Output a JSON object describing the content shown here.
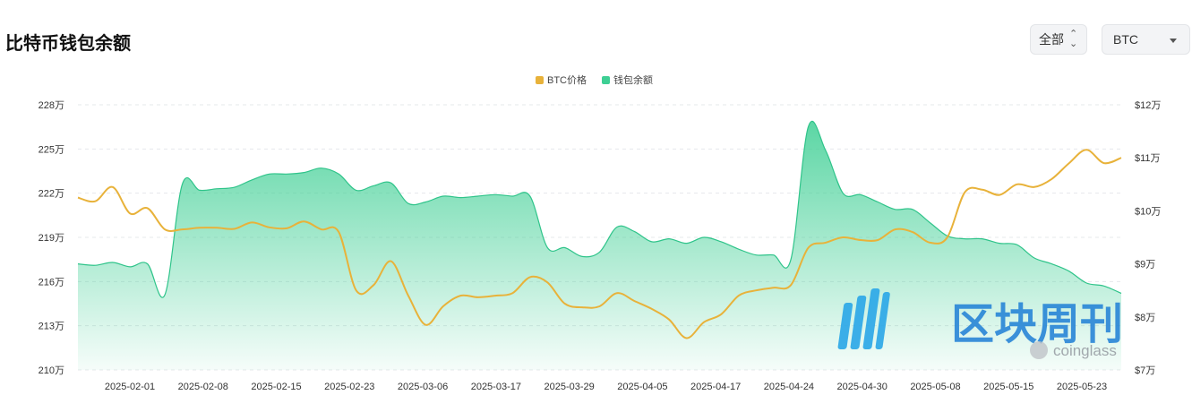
{
  "header": {
    "title": "比特币钱包余额",
    "range_select": {
      "value": "全部"
    },
    "coin_select": {
      "value": "BTC"
    }
  },
  "colors": {
    "price_line": "#e8b23a",
    "balance_fill_top": "#3ecf94",
    "balance_line": "#2fc48a",
    "grid": "#e6e8eb"
  },
  "watermark": {
    "brand_cn": "区块周刊",
    "brand_en": "coinglass"
  },
  "chart_data": {
    "type": "area",
    "legend": [
      {
        "name": "BTC价格",
        "color": "#e8b23a"
      },
      {
        "name": "钱包余额",
        "color": "#3ecf94"
      }
    ],
    "legend_position": "top-center",
    "grid": true,
    "x_tick_labels": [
      "2025-02-01",
      "2025-02-08",
      "2025-02-15",
      "2025-02-23",
      "2025-03-06",
      "2025-03-17",
      "2025-03-29",
      "2025-04-05",
      "2025-04-17",
      "2025-04-24",
      "2025-04-30",
      "2025-05-08",
      "2025-05-15",
      "2025-05-23"
    ],
    "y_left": {
      "min": 2100000,
      "max": 2280000,
      "ticks": [
        2100000,
        2130000,
        2160000,
        2190000,
        2220000,
        2250000,
        2280000
      ],
      "tick_labels": [
        "210万",
        "213万",
        "216万",
        "219万",
        "222万",
        "225万",
        "228万"
      ]
    },
    "y_right": {
      "min": 70000,
      "max": 120000,
      "ticks": [
        70000,
        80000,
        90000,
        100000,
        110000,
        120000
      ],
      "tick_labels": [
        "$7万",
        "$8万",
        "$9万",
        "$10万",
        "$11万",
        "$12万"
      ]
    },
    "x": [
      "01-27",
      "01-29",
      "01-31",
      "02-02",
      "02-04",
      "02-06",
      "02-08",
      "02-10",
      "02-12",
      "02-14",
      "02-16",
      "02-18",
      "02-20",
      "02-22",
      "02-24",
      "02-26",
      "02-28",
      "03-02",
      "03-04",
      "03-06",
      "03-08",
      "03-10",
      "03-12",
      "03-14",
      "03-16",
      "03-18",
      "03-20",
      "03-22",
      "03-24",
      "03-26",
      "03-28",
      "03-30",
      "04-01",
      "04-03",
      "04-05",
      "04-07",
      "04-09",
      "04-11",
      "04-13",
      "04-15",
      "04-17",
      "04-19",
      "04-21",
      "04-23",
      "04-25",
      "04-27",
      "04-29",
      "05-01",
      "05-03",
      "05-05",
      "05-07",
      "05-09",
      "05-11",
      "05-13",
      "05-15",
      "05-17",
      "05-19",
      "05-21",
      "05-23",
      "05-25",
      "05-27"
    ],
    "series": [
      {
        "name": "钱包余额",
        "axis": "left",
        "values": [
          2172000,
          2171000,
          2173000,
          2170000,
          2172000,
          2151000,
          2226000,
          2222000,
          2223000,
          2224000,
          2229000,
          2233000,
          2233000,
          2234000,
          2237000,
          2233000,
          2222000,
          2225000,
          2227000,
          2213000,
          2214000,
          2218000,
          2217000,
          2218000,
          2219000,
          2218000,
          2218000,
          2183000,
          2183000,
          2177000,
          2180000,
          2197000,
          2194000,
          2187000,
          2189000,
          2186000,
          2190000,
          2187000,
          2182000,
          2178000,
          2178000,
          2175000,
          2265000,
          2249000,
          2220000,
          2219000,
          2214000,
          2209000,
          2209000,
          2200000,
          2191000,
          2189000,
          2189000,
          2186000,
          2185000,
          2176000,
          2172000,
          2167000,
          2159000,
          2157000,
          2152000
        ]
      },
      {
        "name": "BTC价格",
        "axis": "right",
        "values": [
          102500,
          101800,
          104500,
          99500,
          100500,
          96500,
          96500,
          96800,
          96800,
          96600,
          97800,
          96900,
          96700,
          98000,
          96500,
          96000,
          85000,
          86000,
          90500,
          84000,
          78500,
          82000,
          84000,
          83700,
          84000,
          84500,
          87500,
          86500,
          82500,
          81800,
          82000,
          84500,
          83000,
          81500,
          79500,
          76000,
          79000,
          80500,
          84000,
          85000,
          85500,
          86000,
          93000,
          94000,
          95000,
          94500,
          94500,
          96500,
          96000,
          94000,
          95000,
          103500,
          104000,
          103000,
          105000,
          104500,
          106000,
          109000,
          111500,
          109000,
          110000
        ]
      }
    ]
  }
}
